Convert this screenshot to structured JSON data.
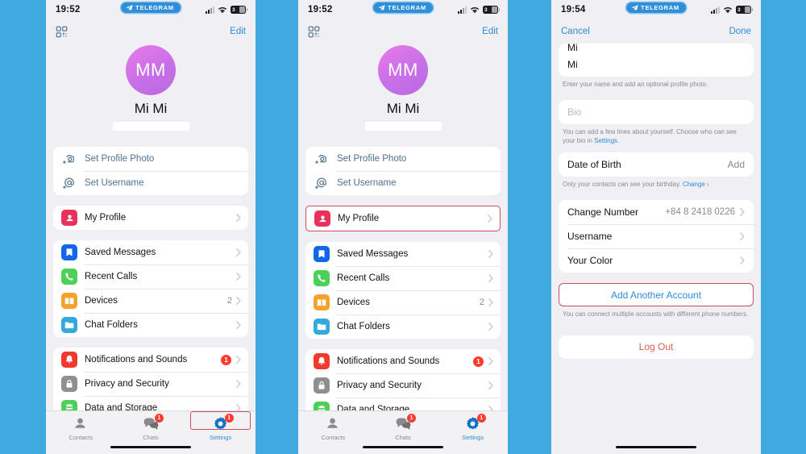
{
  "meta": {
    "background_color": "#3FA9E0",
    "panel_bg": "#EFEFF4",
    "accent_blue": "#2C8CD6",
    "highlight_red": "#C94F5F"
  },
  "status_bar": {
    "time_panel1": "19:52",
    "time_panel2": "19:52",
    "time_panel3": "19:54",
    "watermark": "TELEGRAM",
    "battery_level": "3"
  },
  "panel1": {
    "nav": {
      "qr_icon": "qr-code-icon",
      "edit_label": "Edit"
    },
    "profile": {
      "initials": "MM",
      "name": "Mi Mi"
    },
    "group_setup": [
      {
        "label": "Set Profile Photo",
        "icon": "camera-plus-icon"
      },
      {
        "label": "Set Username",
        "icon": "at-plus-icon"
      }
    ],
    "group_profile": [
      {
        "label": "My Profile",
        "icon": "person-icon",
        "color": "#E8315B",
        "value": ""
      }
    ],
    "group_main": [
      {
        "label": "Saved Messages",
        "icon": "bookmark-icon",
        "color": "#1266E8",
        "value": ""
      },
      {
        "label": "Recent Calls",
        "icon": "phone-icon",
        "color": "#4CD058",
        "value": ""
      },
      {
        "label": "Devices",
        "icon": "devices-icon",
        "color": "#F3A32B",
        "value": "2"
      },
      {
        "label": "Chat Folders",
        "icon": "folder-icon",
        "color": "#34AADC",
        "value": ""
      }
    ],
    "group_settings": [
      {
        "label": "Notifications and Sounds",
        "icon": "bell-icon",
        "color": "#F03A2E",
        "badge": "1"
      },
      {
        "label": "Privacy and Security",
        "icon": "lock-icon",
        "color": "#8E8E93",
        "badge": ""
      },
      {
        "label": "Data and Storage",
        "icon": "database-icon",
        "color": "#4CD058",
        "badge": ""
      }
    ],
    "tabs": [
      {
        "label": "Contacts",
        "icon": "contacts-icon",
        "badge": "",
        "active": false,
        "highlighted": false
      },
      {
        "label": "Chats",
        "icon": "chats-icon",
        "badge": "1",
        "active": false,
        "highlighted": false
      },
      {
        "label": "Settings",
        "icon": "gear-icon",
        "badge": "1",
        "active": true,
        "highlighted": true
      }
    ]
  },
  "panel2": {
    "nav": {
      "qr_icon": "qr-code-icon",
      "edit_label": "Edit"
    },
    "profile": {
      "initials": "MM",
      "name": "Mi Mi"
    },
    "group_setup": [
      {
        "label": "Set Profile Photo",
        "icon": "camera-plus-icon"
      },
      {
        "label": "Set Username",
        "icon": "at-plus-icon"
      }
    ],
    "group_profile": [
      {
        "label": "My Profile",
        "icon": "person-icon",
        "color": "#E8315B",
        "value": "",
        "highlighted": true
      }
    ],
    "group_main": [
      {
        "label": "Saved Messages",
        "icon": "bookmark-icon",
        "color": "#1266E8",
        "value": ""
      },
      {
        "label": "Recent Calls",
        "icon": "phone-icon",
        "color": "#4CD058",
        "value": ""
      },
      {
        "label": "Devices",
        "icon": "devices-icon",
        "color": "#F3A32B",
        "value": "2"
      },
      {
        "label": "Chat Folders",
        "icon": "folder-icon",
        "color": "#34AADC",
        "value": ""
      }
    ],
    "group_settings": [
      {
        "label": "Notifications and Sounds",
        "icon": "bell-icon",
        "color": "#F03A2E",
        "badge": "1"
      },
      {
        "label": "Privacy and Security",
        "icon": "lock-icon",
        "color": "#8E8E93",
        "badge": ""
      },
      {
        "label": "Data and Storage",
        "icon": "database-icon",
        "color": "#4CD058",
        "badge": ""
      }
    ],
    "tabs": [
      {
        "label": "Contacts",
        "icon": "contacts-icon",
        "badge": "",
        "active": false,
        "highlighted": false
      },
      {
        "label": "Chats",
        "icon": "chats-icon",
        "badge": "1",
        "active": false,
        "highlighted": false
      },
      {
        "label": "Settings",
        "icon": "gear-icon",
        "badge": "1",
        "active": true,
        "highlighted": false
      }
    ]
  },
  "panel3": {
    "nav": {
      "cancel_label": "Cancel",
      "done_label": "Done"
    },
    "name_fields": {
      "first_name_clipped": "Mi",
      "last_name": "Mi",
      "hint": "Enter your name and add an optional profile photo."
    },
    "bio": {
      "placeholder": "Bio",
      "hint_before": "You can add a few lines about yourself. Choose who can see your bio in ",
      "hint_link": "Settings",
      "hint_after": "."
    },
    "dob": {
      "label": "Date of Birth",
      "action": "Add",
      "hint_before": "Only your contacts can see your birthday. ",
      "hint_link": "Change ›"
    },
    "account_rows": [
      {
        "label": "Change Number",
        "value": "+84 8 2418 0226"
      },
      {
        "label": "Username",
        "value": ""
      },
      {
        "label": "Your Color",
        "value": ""
      }
    ],
    "add_account": {
      "label": "Add Another Account",
      "hint": "You can connect multiple accounts with different phone numbers.",
      "highlighted": true
    },
    "logout": {
      "label": "Log Out"
    }
  }
}
